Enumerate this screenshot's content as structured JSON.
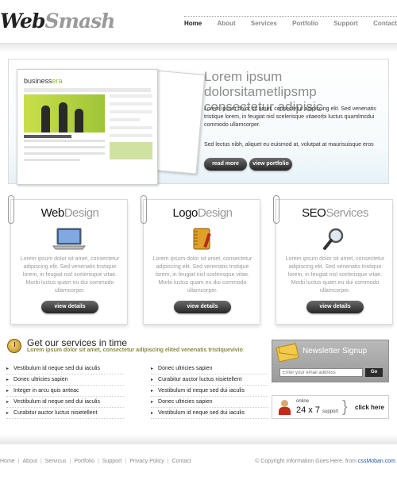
{
  "header": {
    "logo_part1": "Web",
    "logo_part2": "Smash",
    "nav": [
      "Home",
      "About",
      "Services",
      "Portfolio",
      "Support",
      "Contact"
    ]
  },
  "hero": {
    "mini_logo_a": "business",
    "mini_logo_b": "era",
    "title": "Lorem ipsum dolorsitametlipsmp consectetur adipisic",
    "paragraph": "Lorem ipsum dolor sit amet, consectetur adipiscing elit. Sed venenatis tristique lorem, in feugiat nisl scelerisque vitaeorbi luctus quamlmcdui commodo ullamcorper.",
    "paragraph2": "Sed lectus nibh, aliquet eu euismod at, volutpat at maurisuisque eros",
    "btn_read_more": "read more",
    "btn_view_portfolio": "view portfolio"
  },
  "services": [
    {
      "title_dark": "Web",
      "title_light": "Design",
      "icon": "laptop-icon",
      "text": "Lorem ipsum dolor sit amet, consectetur adipiscing elit. Sed venenatis tristique lorem, in feugiat nisl scelerisque vitae. Morbi luctus quam eu dui commodo ullamcorper.",
      "button": "view details"
    },
    {
      "title_dark": "Logo",
      "title_light": "Design",
      "icon": "notebook-pen-icon",
      "text": "Lorem ipsum dolor sit amet, consectetur adipiscing elit. Sed venenatis tristique lorem, in feugiat nisl scelerisque vitae. Morbi luctus quam eu dui commodo ullamcorper.",
      "button": "view details"
    },
    {
      "title_dark": "SEO",
      "title_light": "Services",
      "icon": "magnifier-icon",
      "text": "Lorem ipsum dolor sit amet, consectetur adipiscing elit. Sed venenatis tristique lorem, in feugiat nisl scelerisque vitae. Morbi luctus quam eu dui commodo ullamcorper.",
      "button": "view details"
    }
  ],
  "get_services": {
    "title": "Get our services in time",
    "subtitle": "Lorem ipsum dolor sit amet, consectetur adipiscing elited venenatis tristiquevivio",
    "col1": [
      "Vestibulum id neque sed dui iaculis",
      "Donec ultricies sapien",
      "Integer in arcu quis anteac",
      "Vestibulum id neque sed dui iaculis",
      "Curabitur auctor luctus nisietellent"
    ],
    "col2": [
      "Donec ultricies sapien",
      "Curabitur auctor luctus nisietellent",
      "Vestibulum id neque sed dui iaculis",
      "Donec ultricies sapien",
      "Vestibulum id neque sed dui iaculis"
    ]
  },
  "newsletter": {
    "title": "Newsletter Signup",
    "placeholder": "Enter your email address",
    "go": "Go"
  },
  "support": {
    "online": "online",
    "hours": "24 x 7",
    "label": "support",
    "click": "click here"
  },
  "footer": {
    "links": [
      "Home",
      "About",
      "Servicus",
      "Portfolio",
      "Support",
      "Privacy Policy",
      "Contact"
    ],
    "copyright": "© Copyright Information Goes Here. from",
    "copyright_link": "cssMoban.com"
  }
}
